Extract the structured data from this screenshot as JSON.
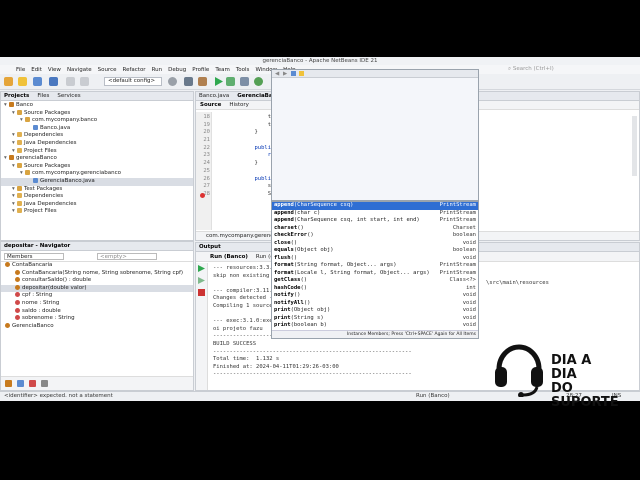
{
  "window": {
    "title": "gerenciaBanco - Apache NetBeans IDE 21"
  },
  "menu": [
    "File",
    "Edit",
    "View",
    "Navigate",
    "Source",
    "Refactor",
    "Run",
    "Debug",
    "Profile",
    "Team",
    "Tools",
    "Window",
    "Help"
  ],
  "search": {
    "placeholder": "Search (Ctrl+I)"
  },
  "toolbar": {
    "config": "<default config>"
  },
  "projects_panel": {
    "tabs": [
      "Projects",
      "Files",
      "Services"
    ],
    "tree": [
      {
        "label": "Banco",
        "indent": 0,
        "icon": "coffee-cup-icon"
      },
      {
        "label": "Source Packages",
        "indent": 1,
        "icon": "package-icon"
      },
      {
        "label": "com.mycompany.banco",
        "indent": 2,
        "icon": "package-icon"
      },
      {
        "label": "Banco.java",
        "indent": 3,
        "icon": "java-file-icon"
      },
      {
        "label": "Dependencies",
        "indent": 1,
        "icon": "folder-icon"
      },
      {
        "label": "Java Dependencies",
        "indent": 1,
        "icon": "folder-icon"
      },
      {
        "label": "Project Files",
        "indent": 1,
        "icon": "folder-icon"
      },
      {
        "label": "gerenciaBanco",
        "indent": 0,
        "icon": "coffee-cup-icon"
      },
      {
        "label": "Source Packages",
        "indent": 1,
        "icon": "package-icon"
      },
      {
        "label": "com.mycompany.gerenciabanco",
        "indent": 2,
        "icon": "package-icon"
      },
      {
        "label": "GerenciaBanco.java",
        "indent": 3,
        "icon": "java-file-icon",
        "selected": true
      },
      {
        "label": "Test Packages",
        "indent": 1,
        "icon": "package-icon"
      },
      {
        "label": "Dependencies",
        "indent": 1,
        "icon": "folder-icon"
      },
      {
        "label": "Java Dependencies",
        "indent": 1,
        "icon": "folder-icon"
      },
      {
        "label": "Project Files",
        "indent": 1,
        "icon": "folder-icon"
      }
    ]
  },
  "navigator": {
    "title": "depositar - Navigator",
    "members_label": "Members",
    "filter": "<empty>",
    "items": [
      {
        "label": "ContaBancaria",
        "indent": 0,
        "color": "#c77a1e"
      },
      {
        "label": "ContaBancaria(String nome, String sobrenome, String cpf)",
        "indent": 1,
        "color": "#c77a1e"
      },
      {
        "label": "consultarSaldo() : double",
        "indent": 1,
        "color": "#c77a1e"
      },
      {
        "label": "depositar(double valor)",
        "indent": 1,
        "color": "#c77a1e",
        "selected": true
      },
      {
        "label": "cpf : String",
        "indent": 1,
        "color": "#d04a4a"
      },
      {
        "label": "nome : String",
        "indent": 1,
        "color": "#d04a4a"
      },
      {
        "label": "saldo : double",
        "indent": 1,
        "color": "#d04a4a"
      },
      {
        "label": "sobrenome : String",
        "indent": 1,
        "color": "#d04a4a"
      },
      {
        "label": "GerenciaBanco",
        "indent": 0,
        "color": "#c77a1e"
      }
    ]
  },
  "editor": {
    "tabs": [
      "Banco.java",
      "GerenciaBanco.java"
    ],
    "subtabs": [
      "Source",
      "History"
    ],
    "lines": [
      {
        "no": "18",
        "text": "            this.cpf"
      },
      {
        "no": "19",
        "text": "            this.sal"
      },
      {
        "no": "20",
        "text": "        }"
      },
      {
        "no": "21",
        "text": ""
      },
      {
        "no": "22",
        "text": "        public double"
      },
      {
        "no": "23",
        "text": "            return s"
      },
      {
        "no": "24",
        "text": "        }"
      },
      {
        "no": "25",
        "text": ""
      },
      {
        "no": "26",
        "text": "        public void d"
      },
      {
        "no": "27",
        "text": "            saldo +="
      },
      {
        "no": "28",
        "text": "            System.out."
      }
    ],
    "breadcrumb": "com.mycompany.gerenciabanco"
  },
  "autocomplete": {
    "items": [
      {
        "name": "append",
        "args": "(CharSequence csq)",
        "type": "PrintStream",
        "selected": true
      },
      {
        "name": "append",
        "args": "(char c)",
        "type": "PrintStream"
      },
      {
        "name": "append",
        "args": "(CharSequence csq, int start, int end)",
        "type": "PrintStream"
      },
      {
        "name": "charset",
        "args": "()",
        "type": "Charset"
      },
      {
        "name": "checkError",
        "args": "()",
        "type": "boolean"
      },
      {
        "name": "close",
        "args": "()",
        "type": "void"
      },
      {
        "name": "equals",
        "args": "(Object obj)",
        "type": "boolean"
      },
      {
        "name": "flush",
        "args": "()",
        "type": "void"
      },
      {
        "name": "format",
        "args": "(String format, Object... args)",
        "type": "PrintStream"
      },
      {
        "name": "format",
        "args": "(Locale l, String format, Object... args)",
        "type": "PrintStream"
      },
      {
        "name": "getClass",
        "args": "()",
        "type": "Class<?>"
      },
      {
        "name": "hashCode",
        "args": "()",
        "type": "int"
      },
      {
        "name": "notify",
        "args": "()",
        "type": "void"
      },
      {
        "name": "notifyAll",
        "args": "()",
        "type": "void"
      },
      {
        "name": "print",
        "args": "(Object obj)",
        "type": "void"
      },
      {
        "name": "print",
        "args": "(String s)",
        "type": "void"
      },
      {
        "name": "print",
        "args": "(boolean b)",
        "type": "void"
      }
    ],
    "footer": "Instance Members; Press 'Ctrl+SPACE' Again for All Items"
  },
  "output": {
    "tab": "Output",
    "run_tab": "Run (Banco)",
    "run_tab2": "Run (ge",
    "right_text": "\\src\\main\\resources",
    "lines": [
      "--- resources:3.3.1:reso",
      "skip non existing resour",
      "",
      "--- compiler:3.11.0:comp",
      "Changes detected - recom",
      "Compiling 1 source file",
      "",
      "--- exec:3.1.0:exec (def",
      "oi projeto fazu",
      "------------------------------------------------------------",
      "BUILD SUCCESS",
      "------------------------------------------------------------",
      "Total time:  1.132 s",
      "Finished at: 2024-04-11T01:29:26-03:00",
      "------------------------------------------------------------"
    ]
  },
  "status": {
    "message": "<identifier> expected. not a statement",
    "run_label": "Run (Banco)",
    "position": "28:27",
    "mode": "INS"
  },
  "logo": {
    "line1": "DIA A DIA",
    "line2": "DO SUPORTE"
  }
}
